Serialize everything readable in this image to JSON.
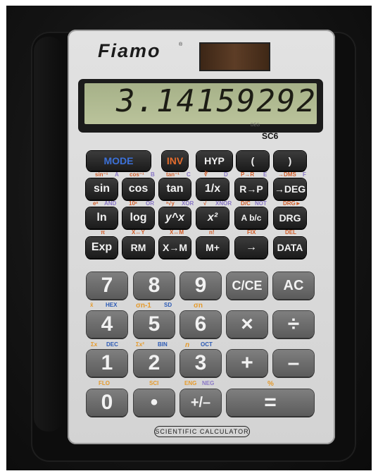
{
  "brand": "Fiamo",
  "display": "3.14159292",
  "display_indicator": "DEG",
  "model": "SC6",
  "footer": "SCIENTIFIC CALCULATOR",
  "keys": {
    "mode": "MODE",
    "inv": "INV",
    "hyp": "HYP",
    "lparen": "(",
    "rparen": ")",
    "sin": "sin",
    "cos": "cos",
    "tan": "tan",
    "recip": "1/x",
    "rp": "R→P",
    "todeg": "→DEG",
    "ln": "ln",
    "log": "log",
    "yx": "y^x",
    "x2": "x²",
    "abc": "A b/c",
    "drg": "DRG",
    "exp": "Exp",
    "rm": "RM",
    "xm": "X→M",
    "mplus": "M+",
    "arrow": "→",
    "data": "DATA",
    "n7": "7",
    "n8": "8",
    "n9": "9",
    "cce": "C/CE",
    "ac": "AC",
    "n4": "4",
    "n5": "5",
    "n6": "6",
    "mul": "×",
    "div": "÷",
    "n1": "1",
    "n2": "2",
    "n3": "3",
    "plus": "+",
    "minus": "–",
    "n0": "0",
    "dot": "•",
    "neg": "+/–",
    "eq": "="
  },
  "shift_labels": {
    "sin_inv": "sin⁻¹",
    "a": "A",
    "cos_inv": "cos⁻¹",
    "b": "B",
    "tan_inv": "tan⁻¹",
    "c": "C",
    "cbrt": "∛",
    "d": "D",
    "pr": "P→R",
    "e": "E",
    "dms": "→DMS",
    "f": "F",
    "ex": "eˣ",
    "and": "AND",
    "ten": "10ˣ",
    "or": "OR",
    "xroot": "ˣ√y",
    "xor": "XOR",
    "sqrt": "√",
    "xnor": "XNOR",
    "dc": "D/C",
    "not": "NOT",
    "drg_arrow": "DRG►",
    "pi": "π",
    "xy": "X↔Y",
    "xm": "X↔M",
    "fact": "n!",
    "fix": "FIX",
    "del": "DEL",
    "xbar": "x̄",
    "hex": "HEX",
    "sn1": "σn-1",
    "sd": "SD",
    "sn": "σn",
    "sumx": "Σx",
    "dec": "DEC",
    "sumx2": "Σx²",
    "bin": "BIN",
    "n": "n",
    "oct": "OCT",
    "flo": "FLO",
    "sci": "SCI",
    "eng": "ENG",
    "neg": "NEG",
    "pct": "%"
  }
}
